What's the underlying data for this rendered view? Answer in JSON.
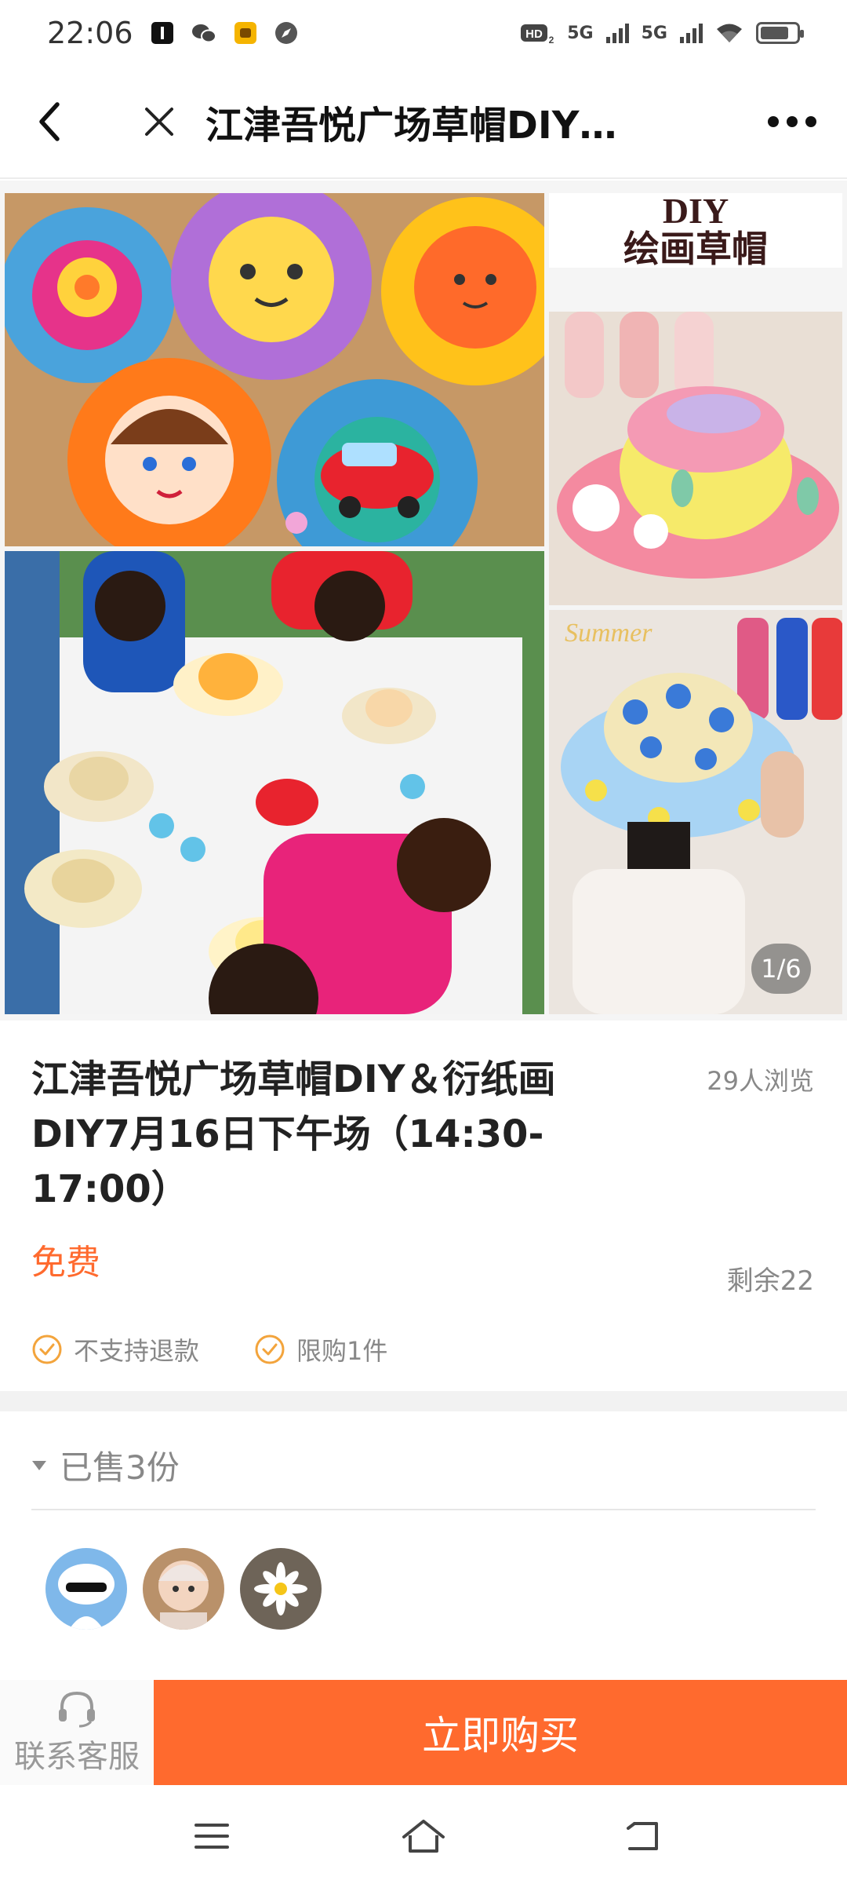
{
  "status_bar": {
    "time": "22:06",
    "network_1": "5G",
    "network_2": "5G",
    "hd_label": "HD",
    "icons": [
      "notification-icon",
      "wechat-icon",
      "app-icon",
      "compass-icon",
      "signal-icon",
      "wifi-icon",
      "battery-icon"
    ],
    "battery_level": 0.8
  },
  "nav": {
    "title": "江津吾悦广场草帽DIY…",
    "icons": [
      "back-icon",
      "close-icon",
      "more-icon"
    ]
  },
  "gallery": {
    "poster_line1": "DIY",
    "poster_line2": "绘画草帽",
    "photo_caption": "Summer",
    "pager": "1/6",
    "current_index": 1,
    "total": 6
  },
  "product": {
    "title": "江津吾悦广场草帽DIY＆衍纸画DIY7月16日下午场（14:30-17:00）",
    "views": "29人浏览",
    "price": "免费",
    "remaining": "剩余22",
    "tags": [
      "不支持退款",
      "限购1件"
    ]
  },
  "sold": {
    "label": "已售3份",
    "avatars": [
      "avatar-cartoon",
      "avatar-baby",
      "avatar-daisy"
    ]
  },
  "bottom": {
    "service_label": "联系客服",
    "buy_label": "立即购买"
  },
  "colors": {
    "accent": "#ff6a2e",
    "muted": "#888888",
    "check": "#f3a43c"
  }
}
